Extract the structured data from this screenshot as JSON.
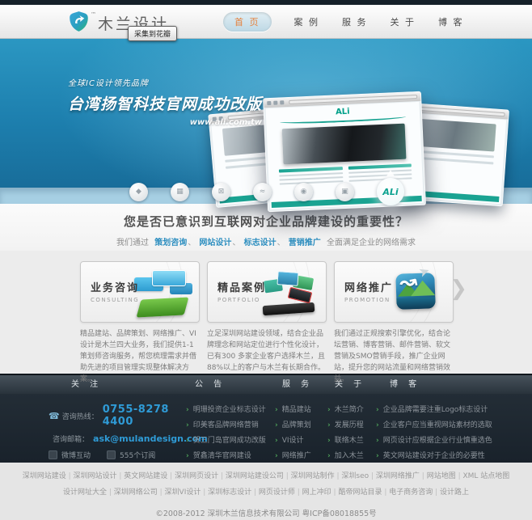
{
  "header": {
    "logo": {
      "text": "木兰设计",
      "tm": "™"
    },
    "nav": [
      {
        "label": "首 页"
      },
      {
        "label": "案 例"
      },
      {
        "label": "服 务"
      },
      {
        "label": "关 于"
      },
      {
        "label": "博 客"
      }
    ],
    "pin_tooltip": "采集到花瓣"
  },
  "banner": {
    "tagline": "全球IC设计领先品牌",
    "title": "台湾扬智科技官网成功改版",
    "url": "www.ali.com.tw",
    "showcase_logo": "ALi",
    "client_badges": [
      "◆",
      "▦",
      "⊠",
      "≈",
      "◉",
      "▣"
    ],
    "featured_badge": "ALi"
  },
  "intro": {
    "heading": "您是否已意识到互联网对企业品牌建设的重要性？",
    "prefix": "我们通过",
    "links": [
      "策划咨询",
      "网站设计",
      "标志设计",
      "营销推广"
    ],
    "separator": "、",
    "suffix": "全面满足企业的网络需求"
  },
  "cards": [
    {
      "title": "业务咨询",
      "subtitle": "CONSULTING",
      "desc": "精品建站、品牌策划、网络推广、VI设计是木兰四大业务，我们提供1-1策划师咨询服务，帮您梳理需求并借助先进的项目管理实现整体解决方案。"
    },
    {
      "title": "精品案例",
      "subtitle": "PORTFOLIO",
      "desc": "立足深圳网站建设领域，结合企业品牌理念和网站定位进行个性化设计，已有300 多家企业客户选择木兰，且88%以上的客户与木兰有长期合作。"
    },
    {
      "title": "网络推广",
      "subtitle": "PROMOTION",
      "desc": "我们通过正规搜索引擎优化，结合论坛营销、博客营销、邮件营销、软文营销及SMO营销手段，推广企业网站，提升您的网站流量和网络营销效益。"
    }
  ],
  "carousel": {
    "next": "❯"
  },
  "footer": {
    "titles": [
      "关 注",
      "公 告",
      "服 务",
      "关 于",
      "博 客"
    ],
    "contact": {
      "hotline_label": "咨询热线：",
      "hotline": "0755-8278 4400",
      "email_label": "咨询邮箱：",
      "email": "ask@mulandesign.com",
      "weibo": "微博互动",
      "rss": "555个订阅",
      "phone_icon": "☎"
    },
    "notices": [
      "明珊投资企业标志设计",
      "印美客品牌网络营销",
      "贺三门岛官网成功改版",
      "贺鑫清华官网建设"
    ],
    "services": [
      "精品建站",
      "品牌策划",
      "VI设计",
      "网络推广"
    ],
    "about": [
      "木兰简介",
      "发展历程",
      "联络木兰",
      "加入木兰"
    ],
    "blog": [
      "企业品牌需要注重Logo标志设计",
      "企业客户应当重视网站素材的选取",
      "网页设计应根据企业行业慎重选色",
      "英文网站建设对于企业的必要性"
    ]
  },
  "bottom": {
    "links_row1": [
      "深圳网站建设",
      "深圳网站设计",
      "英文网站建设",
      "深圳网页设计",
      "深圳网站建设公司",
      "深圳网站制作",
      "深圳seo",
      "深圳网络推广",
      "网站地图",
      "XML 站点地图"
    ],
    "links_row2": [
      "设计网址大全",
      "深圳网络公司",
      "深圳VI设计",
      "深圳标志设计",
      "网页设计师",
      "网上冲印",
      "酷帝网站目录",
      "电子商务咨询",
      "设计路上"
    ],
    "copyright": "©2008-2012 深圳木兰信息技术有限公司 粤ICP备08018855号"
  },
  "colors": {
    "accent_blue": "#2f9bd6",
    "ali_teal": "#1aa392",
    "active_orange": "#e5803b",
    "link_blue": "#2e8fc0",
    "footer_dark": "#1e2831"
  }
}
